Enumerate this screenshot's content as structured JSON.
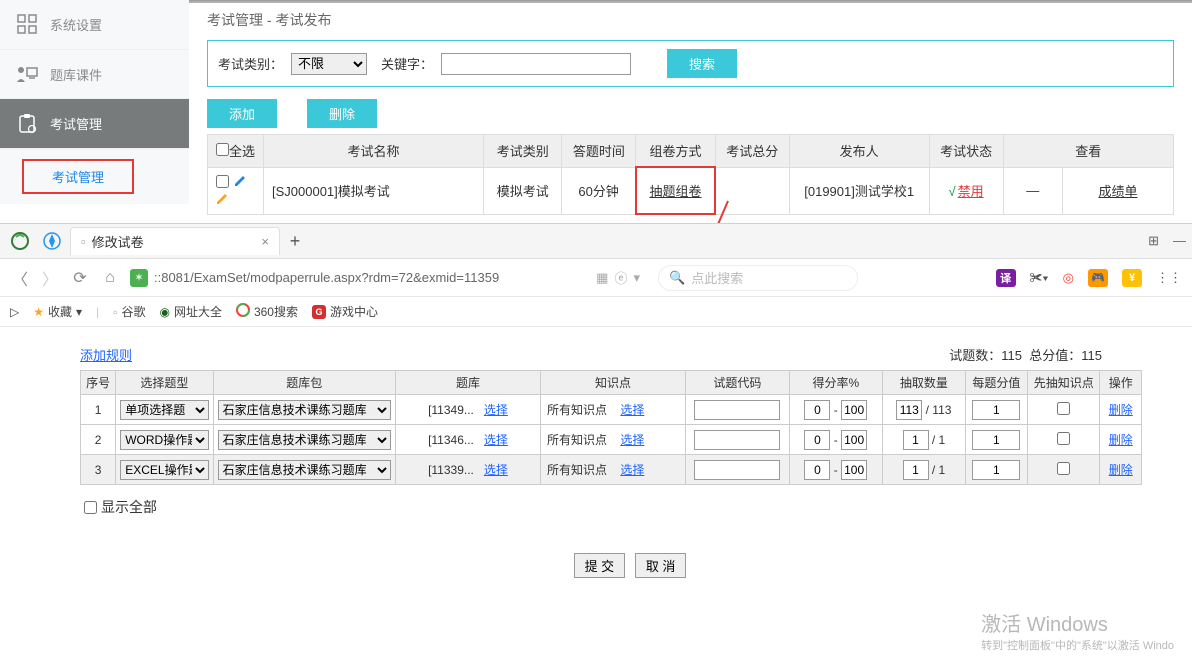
{
  "sidebar": {
    "items": [
      {
        "label": "系统设置"
      },
      {
        "label": "题库课件"
      },
      {
        "label": "考试管理"
      }
    ],
    "sub_label": "考试管理"
  },
  "breadcrumb": "考试管理 - 考试发布",
  "filter": {
    "type_label": "考试类别：",
    "type_option": "不限",
    "keyword_label": "关键字：",
    "search_btn": "搜索"
  },
  "actions": {
    "add": "添加",
    "delete": "删除"
  },
  "exam_table": {
    "headers": {
      "select_all": "全选",
      "name": "考试名称",
      "type": "考试类别",
      "duration": "答题时间",
      "paper_mode": "组卷方式",
      "total": "考试总分",
      "publisher": "发布人",
      "status": "考试状态",
      "view": "查看"
    },
    "row": {
      "name": "[SJ000001]模拟考试",
      "type": "模拟考试",
      "duration": "60分钟",
      "paper_mode": "抽题组卷",
      "total": "",
      "publisher": "[019901]测试学校1",
      "status": "禁用",
      "total_dash": "—",
      "score_link": "成绩单"
    }
  },
  "browser": {
    "tab_title": "修改试卷",
    "url": "::8081/ExamSet/modpaperrule.aspx?rdm=72&exmid=11359",
    "search_placeholder": "点此搜索",
    "bookmarks": {
      "fav": "收藏",
      "google": "谷歌",
      "all": "网址大全",
      "s360": "360搜索",
      "game": "游戏中心"
    },
    "translate": "译"
  },
  "page": {
    "add_rule": "添加规则",
    "stats": {
      "count_label": "试题数：",
      "count": "115",
      "total_label": "总分值：",
      "total": "115"
    },
    "headers": {
      "no": "序号",
      "type": "选择题型",
      "pack": "题库包",
      "bank": "题库",
      "kp": "知识点",
      "code": "试题代码",
      "rate": "得分率%",
      "qty": "抽取数量",
      "score": "每题分值",
      "kp_first": "先抽知识点",
      "op": "操作"
    },
    "kp_all": "所有知识点",
    "select_link": "选择",
    "delete_link": "删除",
    "show_all": "显示全部",
    "submit": "提 交",
    "cancel": "取 消",
    "rows": [
      {
        "no": "1",
        "type": "单项选择题",
        "pack": "石家庄信息技术课练习题库",
        "bank": "[11349...",
        "rmin": "0",
        "rmax": "100",
        "qty": "113",
        "qtotal": "/ 113",
        "score": "1"
      },
      {
        "no": "2",
        "type": "WORD操作题",
        "pack": "石家庄信息技术课练习题库",
        "bank": "[11346...",
        "rmin": "0",
        "rmax": "100",
        "qty": "1",
        "qtotal": "/ 1",
        "score": "1"
      },
      {
        "no": "3",
        "type": "EXCEL操作题",
        "pack": "石家庄信息技术课练习题库",
        "bank": "[11339...",
        "rmin": "0",
        "rmax": "100",
        "qty": "1",
        "qtotal": "/ 1",
        "score": "1"
      }
    ]
  },
  "watermark": {
    "l1": "激活 Windows",
    "l2": "转到\"控制面板\"中的\"系统\"以激活 Windo"
  }
}
